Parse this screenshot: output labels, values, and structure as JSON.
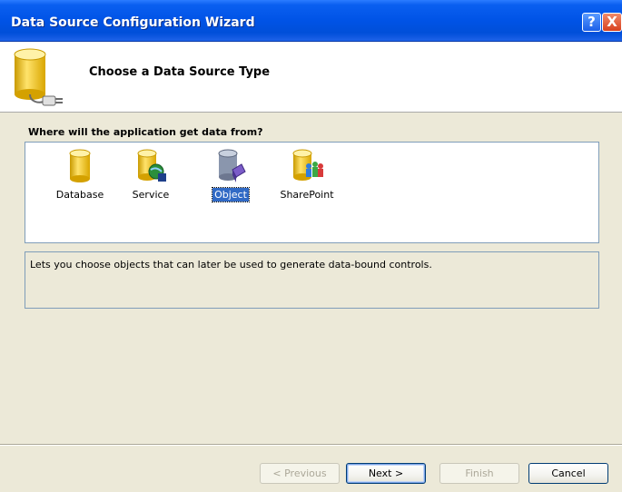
{
  "window": {
    "title": "Data Source Configuration Wizard",
    "help_glyph": "?",
    "close_glyph": "X"
  },
  "header": {
    "title": "Choose a Data Source Type",
    "icon": "database-plug-icon"
  },
  "prompt": "Where will the application get data from?",
  "types": [
    {
      "label": "Database",
      "icon": "database-icon",
      "selected": false
    },
    {
      "label": "Service",
      "icon": "service-icon",
      "selected": false
    },
    {
      "label": "Object",
      "icon": "object-icon",
      "selected": true
    },
    {
      "label": "SharePoint",
      "icon": "sharepoint-icon",
      "selected": false
    }
  ],
  "description": "Lets you choose objects that can later be used to generate data-bound controls.",
  "buttons": {
    "previous": "< Previous",
    "next": "Next >",
    "finish": "Finish",
    "cancel": "Cancel"
  },
  "colors": {
    "titlebar": "#0053e6",
    "selection": "#316ac5",
    "cylinder": "#f5c518"
  }
}
